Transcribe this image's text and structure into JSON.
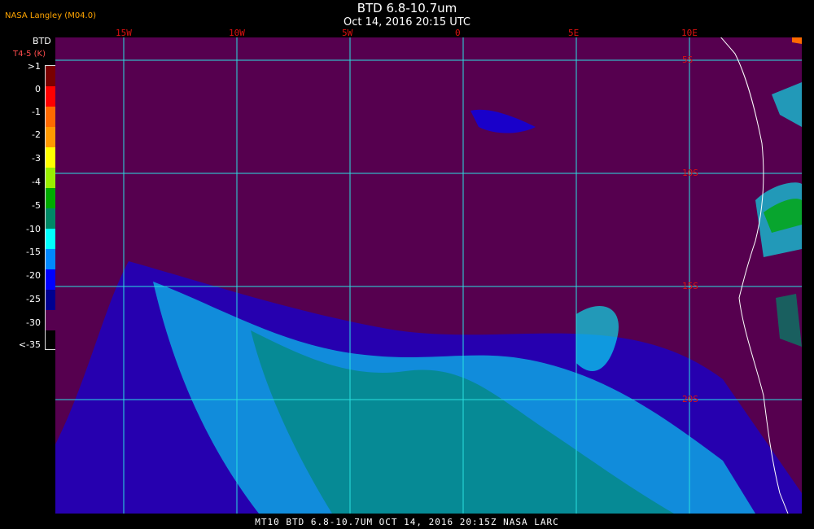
{
  "header": {
    "credit": "NASA Langley (M04.0)",
    "title": "BTD 6.8-10.7um",
    "subtitle": "Oct 14, 2016 20:15 UTC"
  },
  "legend": {
    "title": "BTD",
    "subtitle": "T4-5 (K)",
    "ticks": [
      ">1",
      "0",
      "-1",
      "-2",
      "-3",
      "-4",
      "-5",
      "-10",
      "-15",
      "-20",
      "-25",
      "-30",
      "<-35"
    ],
    "colors": [
      "#7a0000",
      "#ff0000",
      "#ff6a00",
      "#ff9900",
      "#ffff00",
      "#99ee00",
      "#00aa00",
      "#008866",
      "#00ffff",
      "#0088ff",
      "#0000ff",
      "#000090",
      "#56004f"
    ]
  },
  "map": {
    "background": "#56004f",
    "gridline_color": "#29e0e0",
    "longitude_labels": [
      "15W",
      "10W",
      "5W",
      "0",
      "5E",
      "10E"
    ],
    "latitude_labels": [
      "5S",
      "10S",
      "15S",
      "20S"
    ]
  },
  "footer": "MT10  BTD 6.8-10.7UM  OCT 14, 2016 20:15Z  NASA LARC"
}
